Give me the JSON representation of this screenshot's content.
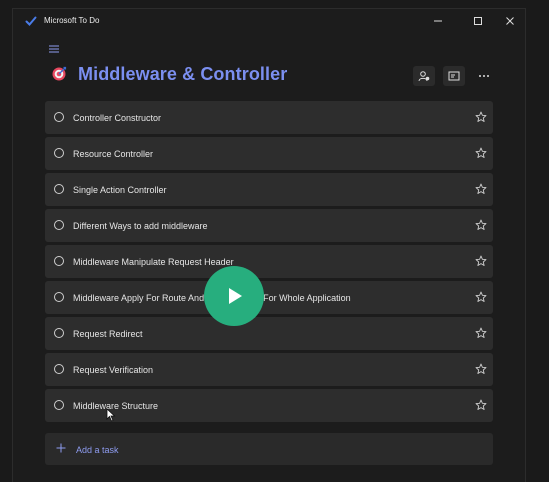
{
  "window": {
    "title": "Microsoft To Do"
  },
  "list": {
    "title": "Middleware & Controller"
  },
  "tasks": [
    {
      "label": "Controller Constructor"
    },
    {
      "label": "Resource Controller"
    },
    {
      "label": "Single Action Controller"
    },
    {
      "label": "Different Ways to add middleware"
    },
    {
      "label": "Middleware Manipulate Request Header"
    },
    {
      "label": "Middleware Apply For Route And Route Group, For Whole Application"
    },
    {
      "label": "Request Redirect"
    },
    {
      "label": "Request Verification"
    },
    {
      "label": "Middleware Structure"
    }
  ],
  "add_task": {
    "label": "Add a task"
  },
  "colors": {
    "accent": "#7b8ff0",
    "play": "#27ae7e",
    "task_bg": "#2d2d2d",
    "window_bg": "#1c1c1c"
  },
  "icons": [
    "check-logo-icon",
    "minimize-icon",
    "maximize-icon",
    "close-icon",
    "hamburger-icon",
    "target-icon",
    "share-person-icon",
    "suggestions-icon",
    "more-icon",
    "circle-icon",
    "star-icon",
    "plus-icon",
    "play-icon",
    "cursor-icon"
  ]
}
